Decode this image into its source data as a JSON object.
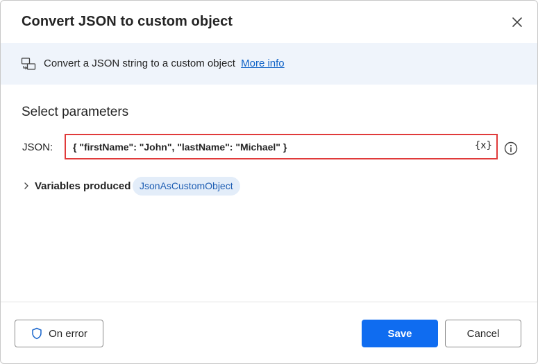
{
  "dialog": {
    "title": "Convert JSON to custom object",
    "close_icon": "close-icon"
  },
  "info": {
    "icon": "convert-icon",
    "description": "Convert a JSON string to a custom object",
    "link": "More info"
  },
  "parameters": {
    "section_title": "Select parameters",
    "json_label": "JSON:",
    "json_value": "{ \"firstName\": \"John\", \"lastName\": \"Michael\" }",
    "variable_button": "{x}",
    "help_icon": "info-circle-icon",
    "field_border_color": "#e03a3a"
  },
  "variables": {
    "label": "Variables produced",
    "chevron_icon": "chevron-right-icon",
    "items": [
      "JsonAsCustomObject"
    ]
  },
  "footer": {
    "on_error_label": "On error",
    "on_error_icon": "shield-icon",
    "save_label": "Save",
    "cancel_label": "Cancel",
    "primary_color": "#0f6cf0"
  }
}
